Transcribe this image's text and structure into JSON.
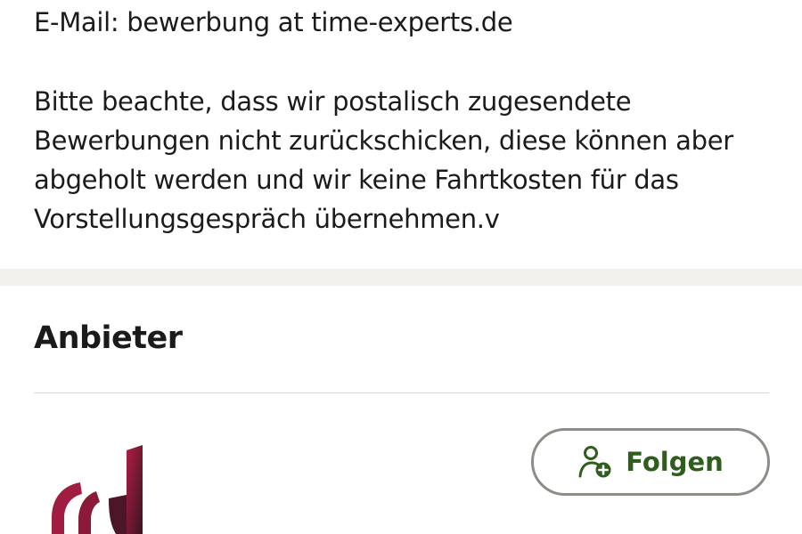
{
  "contact": {
    "email_line": "E-Mail: bewerbung at time-experts.de"
  },
  "notice": {
    "lines": [
      "Bitte beachte, dass wir postalisch zugesendete",
      "Bewerbungen nicht zurückschicken, diese können aber",
      "abgeholt werden und wir keine Fahrtkosten für das",
      "Vorstellungsgespräch übernehmen.v"
    ]
  },
  "provider": {
    "section_title": "Anbieter",
    "logo_icon": "company-logo",
    "follow_button": {
      "label": "Folgen",
      "icon": "person-add-icon"
    }
  },
  "colors": {
    "accent_green": "#2f5d1e",
    "button_border": "#8b8d87",
    "divider_band": "#f2f0ec",
    "logo_red": "#9e1b3c",
    "logo_dark": "#3a1420"
  }
}
